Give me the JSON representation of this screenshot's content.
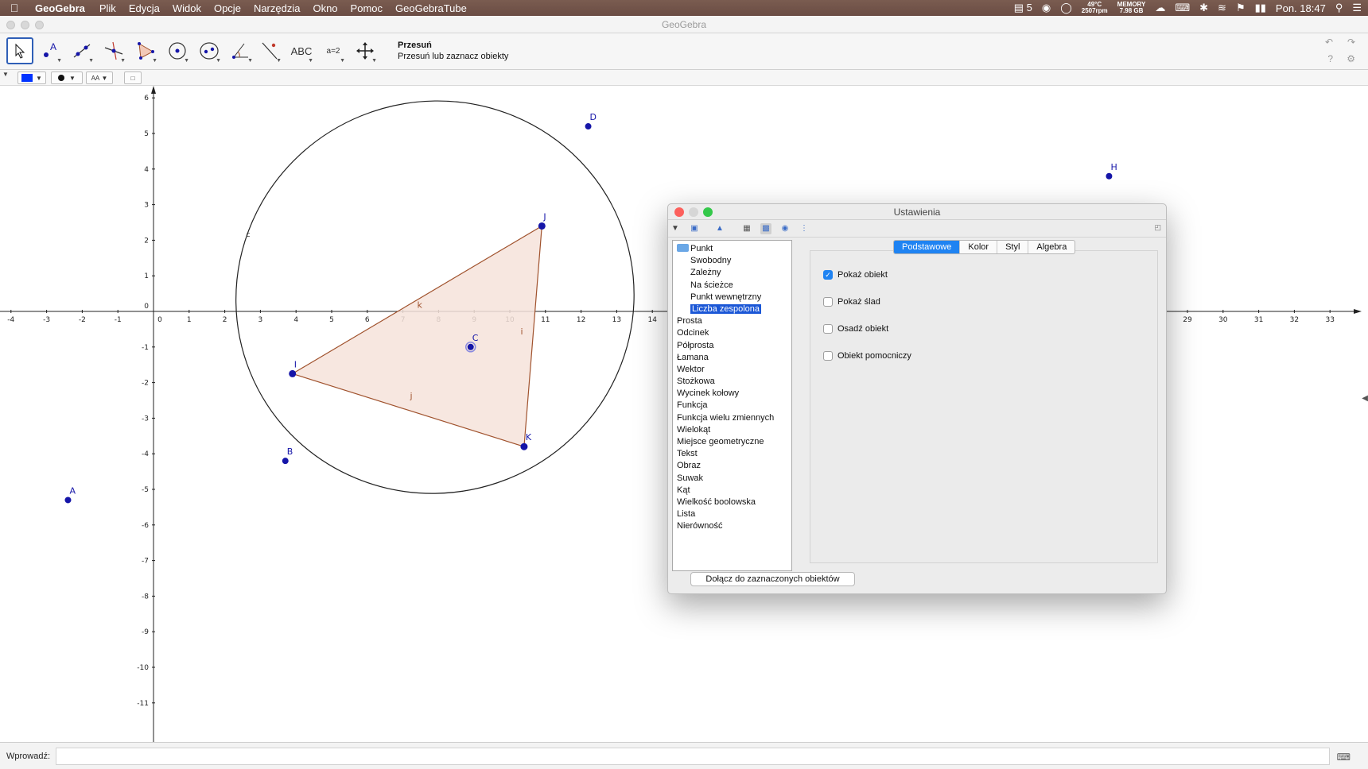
{
  "menubar": {
    "app_name": "GeoGebra",
    "menus": [
      "Plik",
      "Edycja",
      "Widok",
      "Opcje",
      "Narzędzia",
      "Okno",
      "Pomoc",
      "GeoGebraTube"
    ],
    "status": {
      "notes_count": "5",
      "temp": "49°C",
      "rpm": "2507rpm",
      "memory_label": "MEMORY",
      "memory_value": "7.98 GB",
      "clock": "Pon. 18:47"
    }
  },
  "window": {
    "title": "GeoGebra"
  },
  "toolbar": {
    "text_tool_label": "ABC",
    "slider_tool_label": "a=2",
    "help_title": "Przesuń",
    "help_text": "Przesuń lub zaznacz obiekty"
  },
  "colors": {
    "point": "#1515a8",
    "polygon_fill": "#f6e3da",
    "polygon_edge": "#a0522d",
    "accent": "#1f83f2",
    "style_color": "#0033ff"
  },
  "graphics": {
    "x_ticks": [
      "-4",
      "-3",
      "-2",
      "-1",
      "0",
      "1",
      "2",
      "3",
      "4",
      "5",
      "6",
      "7",
      "8",
      "9",
      "10",
      "11",
      "12",
      "13",
      "14",
      "29",
      "30",
      "31",
      "32",
      "33"
    ],
    "y_ticks": [
      "6",
      "5",
      "4",
      "3",
      "2",
      "1",
      "0",
      "-1",
      "-2",
      "-3",
      "-4",
      "-5",
      "-6",
      "-7",
      "-8",
      "-9",
      "-10",
      "-11"
    ],
    "points": [
      {
        "label": "A",
        "x": -2.4,
        "y": -5.3
      },
      {
        "label": "B",
        "x": 3.7,
        "y": -4.2
      },
      {
        "label": "C",
        "x": 8.9,
        "y": -1.0
      },
      {
        "label": "D",
        "x": 12.2,
        "y": 5.2
      },
      {
        "label": "H",
        "x": 26.8,
        "y": 3.8
      },
      {
        "label": "I",
        "x": 3.9,
        "y": -1.75
      },
      {
        "label": "J",
        "x": 10.9,
        "y": 2.4
      },
      {
        "label": "K",
        "x": 10.4,
        "y": -3.8
      }
    ],
    "segment_labels": {
      "k": "k",
      "i": "i",
      "j": "j"
    },
    "conic_label": "c"
  },
  "input_bar": {
    "label": "Wprowadź:"
  },
  "dialog": {
    "title": "Ustawienia",
    "tree": [
      {
        "label": "Punkt",
        "level": 0,
        "folder": true
      },
      {
        "label": "Swobodny",
        "level": 1
      },
      {
        "label": "Zależny",
        "level": 1
      },
      {
        "label": "Na ścieżce",
        "level": 1
      },
      {
        "label": "Punkt wewnętrzny",
        "level": 1
      },
      {
        "label": "Liczba zespolona",
        "level": 1,
        "selected": true
      },
      {
        "label": "Prosta",
        "level": 0
      },
      {
        "label": "Odcinek",
        "level": 0
      },
      {
        "label": "Półprosta",
        "level": 0
      },
      {
        "label": "Łamana",
        "level": 0
      },
      {
        "label": "Wektor",
        "level": 0
      },
      {
        "label": "Stożkowa",
        "level": 0
      },
      {
        "label": "Wycinek kołowy",
        "level": 0
      },
      {
        "label": "Funkcja",
        "level": 0
      },
      {
        "label": "Funkcja wielu zmiennych",
        "level": 0
      },
      {
        "label": "Wielokąt",
        "level": 0
      },
      {
        "label": "Miejsce geometryczne",
        "level": 0
      },
      {
        "label": "Tekst",
        "level": 0
      },
      {
        "label": "Obraz",
        "level": 0
      },
      {
        "label": "Suwak",
        "level": 0
      },
      {
        "label": "Kąt",
        "level": 0
      },
      {
        "label": "Wielkość boolowska",
        "level": 0
      },
      {
        "label": "Lista",
        "level": 0
      },
      {
        "label": "Nierówność",
        "level": 0
      }
    ],
    "tabs": [
      "Podstawowe",
      "Kolor",
      "Styl",
      "Algebra"
    ],
    "active_tab": "Podstawowe",
    "checkboxes": [
      {
        "label": "Pokaż obiekt",
        "checked": true
      },
      {
        "label": "Pokaż ślad",
        "checked": false
      },
      {
        "label": "Osadź obiekt",
        "checked": false
      },
      {
        "label": "Obiekt pomocniczy",
        "checked": false
      }
    ],
    "apply_button": "Dołącz do zaznaczonych obiektów"
  }
}
